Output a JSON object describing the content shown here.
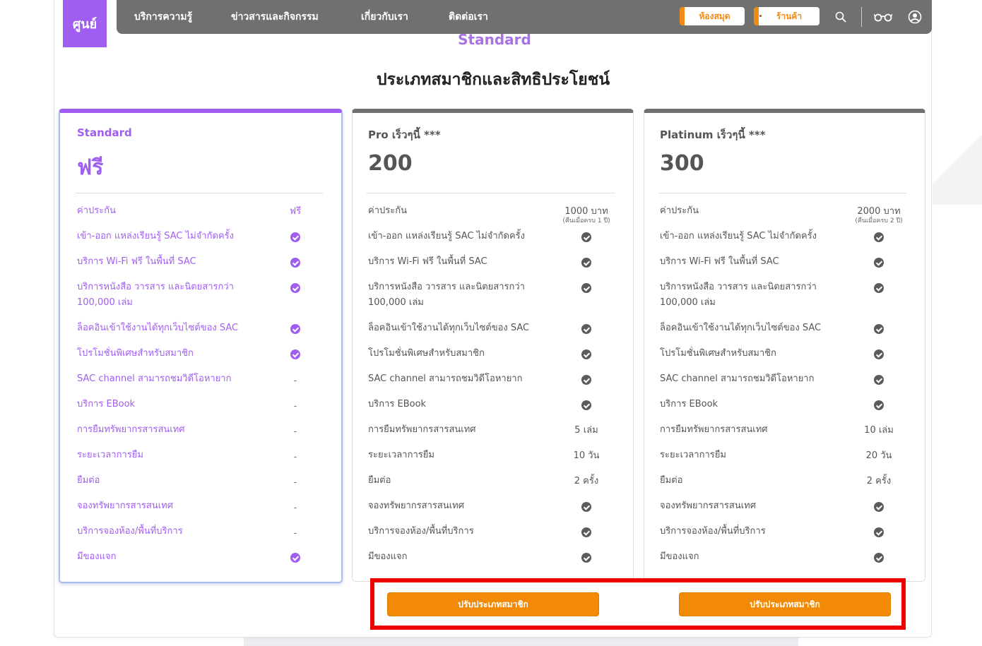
{
  "nav": {
    "logo_text": "ศูนย์",
    "items": [
      "บริการความรู้",
      "ข่าวสารและกิจกรรม",
      "เกี่ยวกับเรา",
      "ติดต่อเรา"
    ],
    "library_btn": "ห้องสมุด",
    "shop_btn": "ร้านค้า"
  },
  "ghost_text": "Standard",
  "section_title": "ประเภทสมาชิกและสิทธิประโยชน์",
  "colors": {
    "accent_purple": "#a05ef0",
    "nav_gray": "#707070",
    "orange": "#f28a05",
    "highlight_red": "#ee0000"
  },
  "features": [
    "ค่าประกัน",
    "เข้า-ออก แหล่งเรียนรู้ SAC ไม่จำกัดครั้ง",
    "บริการ Wi-Fi ฟรี ในพื้นที่ SAC",
    "บริการหนังสือ วารสาร และนิตยสารกว่า",
    "100,000 เล่ม",
    "ล็อคอินเข้าใช้งานได้ทุกเว็บไซต์ของ SAC",
    "โปรโมชั่นพิเศษสำหรับสมาชิก",
    "SAC channel สามารถชมวิดีโอหายาก",
    "บริการ EBook",
    "การยืมทรัพยากรสารสนเทศ",
    "ระยะเวลาการยืม",
    "ยืมต่อ",
    "จองทรัพยากรสารสนเทศ",
    "บริการจองห้อง/พื้นที่บริการ",
    "มีของแจก"
  ],
  "cards": [
    {
      "name": "Standard",
      "price": "ฟรี",
      "deposit": "ฟรี",
      "deposit_note": "",
      "values": [
        "check",
        "check",
        "check",
        "check",
        "check",
        "dash",
        "dash",
        "dash",
        "dash",
        "dash",
        "dash",
        "dash",
        "check"
      ]
    },
    {
      "name": "Pro เร็วๆนี้ ***",
      "price": "200",
      "deposit": "1000 บาท",
      "deposit_note": "(คืนเมื่อครบ 1 ปี)",
      "values": [
        "check",
        "check",
        "check",
        "check",
        "check",
        "check",
        "check",
        "5 เล่ม",
        "10 วัน",
        "2 ครั้ง",
        "check",
        "check",
        "check"
      ]
    },
    {
      "name": "Platinum เร็วๆนี้ ***",
      "price": "300",
      "deposit": "2000 บาท",
      "deposit_note": "(คืนเมื่อครบ 2 ปี)",
      "values": [
        "check",
        "check",
        "check",
        "check",
        "check",
        "check",
        "check",
        "10 เล่ม",
        "20 วัน",
        "2 ครั้ง",
        "check",
        "check",
        "check"
      ]
    }
  ],
  "upgrade_label": "ปรับประเภทสมาชิก"
}
